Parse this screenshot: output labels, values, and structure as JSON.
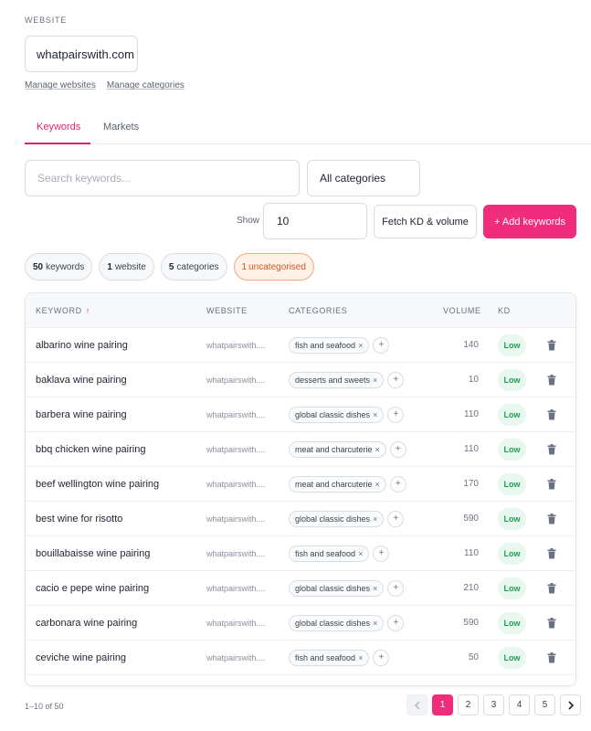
{
  "header": {
    "website_label": "WEBSITE",
    "website_value": "whatpairswith.com",
    "manage_websites": "Manage websites",
    "manage_categories": "Manage categories"
  },
  "tabs": [
    {
      "label": "Keywords",
      "active": true
    },
    {
      "label": "Markets",
      "active": false
    }
  ],
  "filters": {
    "search_placeholder": "Search keywords...",
    "category_value": "All categories",
    "show_label": "Show",
    "show_value": "10",
    "fetch_label": "Fetch KD & volume",
    "add_label": "+ Add keywords"
  },
  "chips": [
    {
      "num": "50",
      "text": "keywords"
    },
    {
      "num": "1",
      "text": "website"
    },
    {
      "num": "5",
      "text": "categories"
    },
    {
      "num": "1",
      "text": "uncategorised"
    }
  ],
  "table": {
    "headers": {
      "keyword": "KEYWORD",
      "website": "WEBSITE",
      "categories": "CATEGORIES",
      "volume": "VOLUME",
      "kd": "KD"
    },
    "sort_arrow": "↑",
    "rows": [
      {
        "keyword": "albarino wine pairing",
        "website": "whatpairswith....",
        "category": "fish and seafood",
        "volume": "140",
        "kd": "Low"
      },
      {
        "keyword": "baklava wine pairing",
        "website": "whatpairswith....",
        "category": "desserts and sweets",
        "volume": "10",
        "kd": "Low"
      },
      {
        "keyword": "barbera wine pairing",
        "website": "whatpairswith....",
        "category": "global classic dishes",
        "volume": "110",
        "kd": "Low"
      },
      {
        "keyword": "bbq chicken wine pairing",
        "website": "whatpairswith....",
        "category": "meat and charcuterie",
        "volume": "110",
        "kd": "Low"
      },
      {
        "keyword": "beef wellington wine pairing",
        "website": "whatpairswith....",
        "category": "meat and charcuterie",
        "volume": "170",
        "kd": "Low"
      },
      {
        "keyword": "best wine for risotto",
        "website": "whatpairswith....",
        "category": "global classic dishes",
        "volume": "590",
        "kd": "Low"
      },
      {
        "keyword": "bouillabaisse wine pairing",
        "website": "whatpairswith....",
        "category": "fish and seafood",
        "volume": "110",
        "kd": "Low"
      },
      {
        "keyword": "cacio e pepe wine pairing",
        "website": "whatpairswith....",
        "category": "global classic dishes",
        "volume": "210",
        "kd": "Low"
      },
      {
        "keyword": "carbonara wine pairing",
        "website": "whatpairswith....",
        "category": "global classic dishes",
        "volume": "590",
        "kd": "Low"
      },
      {
        "keyword": "ceviche wine pairing",
        "website": "whatpairswith....",
        "category": "fish and seafood",
        "volume": "50",
        "kd": "Low"
      }
    ]
  },
  "footer": {
    "count_text": "1–10 of 50",
    "pages": [
      "1",
      "2",
      "3",
      "4",
      "5"
    ],
    "current_page": "1"
  },
  "icons": {
    "remove_category": "close-icon",
    "add_category": "plus-icon",
    "delete": "trash-icon",
    "prev": "chevron-left-icon",
    "next": "chevron-right-icon"
  },
  "colors": {
    "accent": "#f02d7d",
    "kd_low_bg": "#e8f8ee",
    "kd_low_text": "#1f9d55",
    "warn_chip": "#d2581d"
  }
}
